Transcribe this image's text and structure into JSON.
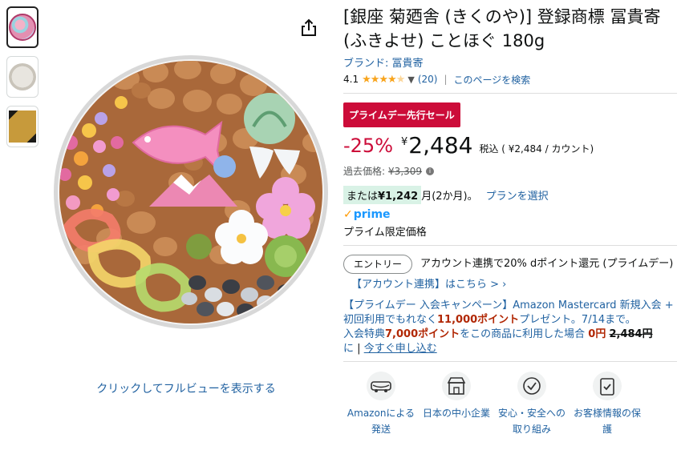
{
  "product": {
    "title": "[銀座 菊廼舎 (きくのや)] 登録商標 冨貴寄 (ふきよせ) ことほぐ 180g",
    "brand": "ブランド: 冨貴寄",
    "rating_value": "4.1",
    "rating_stars": 4.1,
    "review_count": "(20)",
    "search_page": "このページを検索",
    "image_caption": "クリックしてフルビューを表示する"
  },
  "deal": {
    "badge": "プライムデー先行セール",
    "discount": "-25%",
    "currency": "¥",
    "price": "2,484",
    "tax_note": "税込 ( ¥2,484 / カウント)",
    "list_label": "過去価格:",
    "list_price": "¥3,309"
  },
  "plan": {
    "prefix": "または",
    "amount": "¥1,242",
    "suffix": "月(2か月)。",
    "link": "プランを選択"
  },
  "prime": {
    "logo": "prime",
    "label": "プライム限定価格"
  },
  "entry": {
    "button": "エントリー",
    "text": "アカウント連携で20% dポイント還元 (プライムデー)",
    "link": "【アカウント連携】はこちら > ›"
  },
  "campaign": {
    "part1": "【プライムデー 入会キャンペーン】Amazon Mastercard 新規入会 + 初回利用でもれなく",
    "points": "11,000ポイント",
    "part2": "プレゼント。7/14まで。",
    "line2_prefix": "入会特典",
    "points2": "7,000ポイント",
    "line2_mid": "をこの商品に利用した場合",
    "zero": "0円",
    "old": "2,484円",
    "line3_prefix": "に",
    "apply": "今すぐ申し込む"
  },
  "features": [
    {
      "label": "Amazonによる発送",
      "icon": "truck-icon"
    },
    {
      "label": "日本の中小企業",
      "icon": "store-icon"
    },
    {
      "label": "安心・安全への取り組み",
      "icon": "badge-icon"
    },
    {
      "label": "お客様情報の保護",
      "icon": "shield-icon"
    }
  ],
  "colors": {
    "deal_red": "#cc0c39",
    "link_blue": "#2162a1",
    "star_orange": "#f8a41d",
    "prime_blue": "#1a98ff",
    "price_red": "#b12704"
  }
}
